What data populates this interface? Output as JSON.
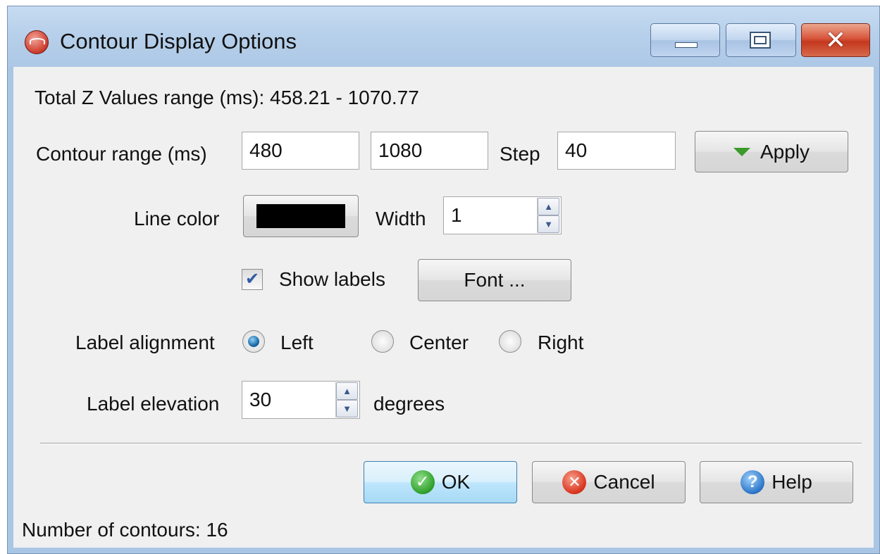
{
  "window": {
    "title": "Contour Display Options"
  },
  "info": {
    "z_range": "Total Z Values range (ms): 458.21 - 1070.77"
  },
  "contour": {
    "label": "Contour range  (ms)",
    "min": "480",
    "max": "1080",
    "step_label": "Step",
    "step": "40",
    "apply_label": "Apply"
  },
  "line": {
    "color_label": "Line color",
    "color": "#000000",
    "width_label": "Width",
    "width": "1"
  },
  "labels": {
    "show_labels": "Show labels",
    "show_labels_checked": true,
    "font_button": "Font ...",
    "alignment_label": "Label alignment",
    "alignment_options": [
      "Left",
      "Center",
      "Right"
    ],
    "alignment_selected": "Left",
    "elevation_label": "Label elevation",
    "elevation": "30",
    "elevation_unit": "degrees"
  },
  "buttons": {
    "ok": "OK",
    "cancel": "Cancel",
    "help": "Help"
  },
  "status": {
    "contours": "Number of contours: 16"
  }
}
